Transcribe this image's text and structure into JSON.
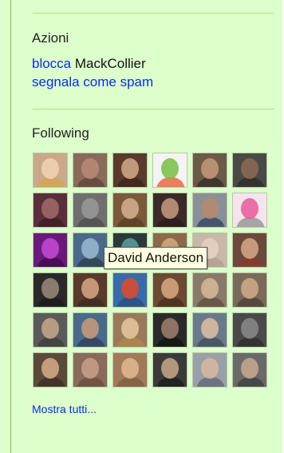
{
  "actions": {
    "title": "Azioni",
    "block_link": "blocca",
    "block_user": "MackCollier",
    "spam_link": "segnala come spam"
  },
  "following": {
    "title": "Following",
    "tooltip": "David Anderson",
    "show_all": "Mostra tutti...",
    "avatars": [
      {
        "bg": "#c9a98a",
        "face": "#f1d2b5",
        "body": "#d9a44a"
      },
      {
        "bg": "#8a6b5a",
        "face": "#b98a78",
        "body": "#5a3f35"
      },
      {
        "bg": "#5a3a2a",
        "face": "#d7a98a",
        "body": "#3a2018"
      },
      {
        "bg": "#f4f4f4",
        "face": "#76c043",
        "body": "#e84a1c"
      },
      {
        "bg": "#6b5a45",
        "face": "#c49a7a",
        "body": "#2d2a26"
      },
      {
        "bg": "#4a4a45",
        "face": "#8c6a52",
        "body": "#2a2a28"
      },
      {
        "bg": "#5a2f3a",
        "face": "#a06a6a",
        "body": "#3a1a24"
      },
      {
        "bg": "#6f6f6f",
        "face": "#9a9a9a",
        "body": "#4a4a4a"
      },
      {
        "bg": "#7a5a3a",
        "face": "#d6b090",
        "body": "#5a3a22"
      },
      {
        "bg": "#3a2a2a",
        "face": "#c89a80",
        "body": "#2a1a18"
      },
      {
        "bg": "#8a9098",
        "face": "#b88a6a",
        "body": "#2a3a5a"
      },
      {
        "bg": "#f4e4ec",
        "face": "#e65a9a",
        "body": "#888888"
      },
      {
        "bg": "#6a1a7a",
        "face": "#c64ad6",
        "body": "#3a0a4a"
      },
      {
        "bg": "#4a6a8a",
        "face": "#9ab8d0",
        "body": "#2a3a4a"
      },
      {
        "bg": "#2a3a3a",
        "face": "#5aa0a0",
        "body": "#1a2a2a"
      },
      {
        "bg": "#8a6a4a",
        "face": "#d6a882",
        "body": "#6a4a2a"
      },
      {
        "bg": "#c8b8a8",
        "face": "#e8d0c0",
        "body": "#b09a8a"
      },
      {
        "bg": "#6a4a3a",
        "face": "#d8a888",
        "body": "#8a3a2a"
      },
      {
        "bg": "#2a2a2a",
        "face": "#9a8a7a",
        "body": "#1a1a1a"
      },
      {
        "bg": "#5a3a2a",
        "face": "#d8a888",
        "body": "#3a2a22"
      },
      {
        "bg": "#3a6aa8",
        "face": "#e04a2a",
        "body": "#2a4a7a"
      },
      {
        "bg": "#6a4a32",
        "face": "#d8a884",
        "body": "#4a2a1a"
      },
      {
        "bg": "#8a7a6a",
        "face": "#d8b898",
        "body": "#5a4a3a"
      },
      {
        "bg": "#7a6a5a",
        "face": "#d0aa8a",
        "body": "#4a3a30"
      },
      {
        "bg": "#5a5a5a",
        "face": "#c8a888",
        "body": "#3a3a3a"
      },
      {
        "bg": "#4a6a8a",
        "face": "#c89a7a",
        "body": "#2a3a5a"
      },
      {
        "bg": "#9a7a5a",
        "face": "#e8c8a0",
        "body": "#b08a4a"
      },
      {
        "bg": "#2a2a2a",
        "face": "#a08070",
        "body": "#101010"
      },
      {
        "bg": "#6a7a8a",
        "face": "#e0c0a0",
        "body": "#3a4a5a"
      },
      {
        "bg": "#4a4a4a",
        "face": "#8a8a8a",
        "body": "#2a2a2a"
      },
      {
        "bg": "#5a4a3a",
        "face": "#d8aa88",
        "body": "#3a2a22"
      },
      {
        "bg": "#8a6a5a",
        "face": "#c8a08a",
        "body": "#6a4a3a"
      },
      {
        "bg": "#a07a5a",
        "face": "#e0b890",
        "body": "#7a5a3a"
      },
      {
        "bg": "#3a3a3a",
        "face": "#c8a888",
        "body": "#1a1a1a"
      },
      {
        "bg": "#9aa0a8",
        "face": "#d8b8a0",
        "body": "#5a6070"
      },
      {
        "bg": "#6a6a6a",
        "face": "#c8a890",
        "body": "#3a3a3a"
      }
    ]
  }
}
